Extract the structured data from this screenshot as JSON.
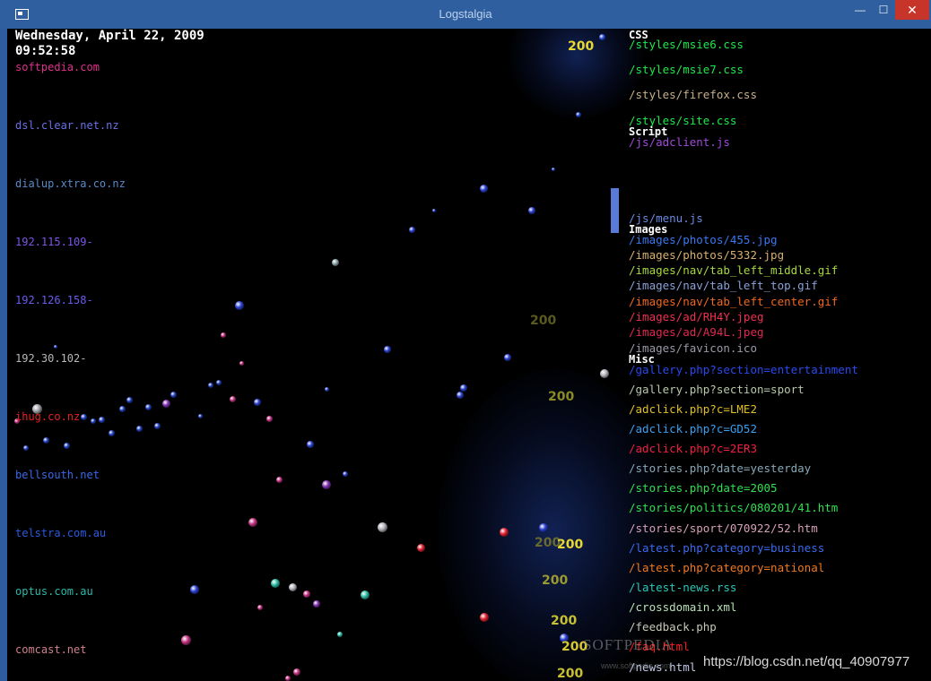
{
  "window": {
    "title": "Logstalgia",
    "min_glyph": "—",
    "max_glyph": "☐",
    "close_glyph": "✕"
  },
  "clock": {
    "date": "Wednesday, April 22, 2009",
    "time": "09:52:58"
  },
  "hosts": [
    {
      "label": "softpedia.com",
      "color": "#e0308c"
    },
    {
      "label": "dsl.clear.net.nz",
      "color": "#6a70e8"
    },
    {
      "label": "dialup.xtra.co.nz",
      "color": "#5a8ac8"
    },
    {
      "label": "192.115.109-",
      "color": "#7b56e8"
    },
    {
      "label": "192.126.158-",
      "color": "#6a5cf0"
    },
    {
      "label": "192.30.102-",
      "color": "#b8b8b8"
    },
    {
      "label": "ihug.co.nz",
      "color": "#e82020"
    },
    {
      "label": "bellsouth.net",
      "color": "#3a6ae8"
    },
    {
      "label": "telstra.com.au",
      "color": "#2a5ae0"
    },
    {
      "label": "optus.com.au",
      "color": "#2ab8a8"
    },
    {
      "label": "comcast.net",
      "color": "#d0808c"
    }
  ],
  "sections": [
    {
      "label": "CSS",
      "pages": [
        {
          "label": "/styles/msie6.css",
          "color": "#1ee84a"
        },
        {
          "label": "/styles/msie7.css",
          "color": "#1ee84a"
        },
        {
          "label": "/styles/firefox.css",
          "color": "#c8b08a"
        },
        {
          "label": "/styles/site.css",
          "color": "#1ee84a"
        }
      ]
    },
    {
      "label": "Script",
      "pages": [
        {
          "label": "/js/adclient.js",
          "color": "#a04ad8"
        },
        {
          "label": "/js/menu.js",
          "color": "#6a8ae0"
        }
      ]
    },
    {
      "label": "Images",
      "pages": [
        {
          "label": "/images/photos/455.jpg",
          "color": "#3a78f0"
        },
        {
          "label": "/images/photos/5332.jpg",
          "color": "#d8b070"
        },
        {
          "label": "/images/nav/tab_left_middle.gif",
          "color": "#a8d840"
        },
        {
          "label": "/images/nav/tab_left_top.gif",
          "color": "#8aa0d8"
        },
        {
          "label": "/images/nav/tab_left_center.gif",
          "color": "#f06820"
        },
        {
          "label": "/images/ad/RH4Y.jpeg",
          "color": "#f03050"
        },
        {
          "label": "/images/ad/A94L.jpeg",
          "color": "#e02850"
        },
        {
          "label": "/images/favicon.ico",
          "color": "#9a9aa8"
        }
      ]
    },
    {
      "label": "Misc",
      "pages": [
        {
          "label": "/gallery.php?section=entertainment",
          "color": "#2a4af0"
        },
        {
          "label": "/gallery.php?section=sport",
          "color": "#b8c8a8"
        },
        {
          "label": "/adclick.php?c=LME2",
          "color": "#e0c020"
        },
        {
          "label": "/adclick.php?c=GD52",
          "color": "#3aa0f0"
        },
        {
          "label": "/adclick.php?c=2ER3",
          "color": "#f02040"
        },
        {
          "label": "/stories.php?date=yesterday",
          "color": "#88a8b8"
        },
        {
          "label": "/stories.php?date=2005",
          "color": "#30e050"
        },
        {
          "label": "/stories/politics/080201/41.htm",
          "color": "#30e050"
        },
        {
          "label": "/stories/sport/070922/52.htm",
          "color": "#d8a0b8"
        },
        {
          "label": "/latest.php?category=business",
          "color": "#3a6af0"
        },
        {
          "label": "/latest.php?category=national",
          "color": "#f07a20"
        },
        {
          "label": "/latest-news.rss",
          "color": "#2ac8b8"
        },
        {
          "label": "/crossdomain.xml",
          "color": "#b8e0b8"
        },
        {
          "label": "/feedback.php",
          "color": "#c8c8b8"
        },
        {
          "label": "/faq.html",
          "color": "#f02020"
        },
        {
          "label": "/news.html",
          "color": "#c0c8e8"
        }
      ]
    }
  ],
  "responses": [
    "200",
    "200",
    "200",
    "200",
    "200",
    "200",
    "200",
    "200",
    "200"
  ],
  "watermark": {
    "brand": "SOFTPEDIA",
    "site": "www.softpedia.com"
  },
  "overlay_url": "https://blog.csdn.net/qq_40907977"
}
